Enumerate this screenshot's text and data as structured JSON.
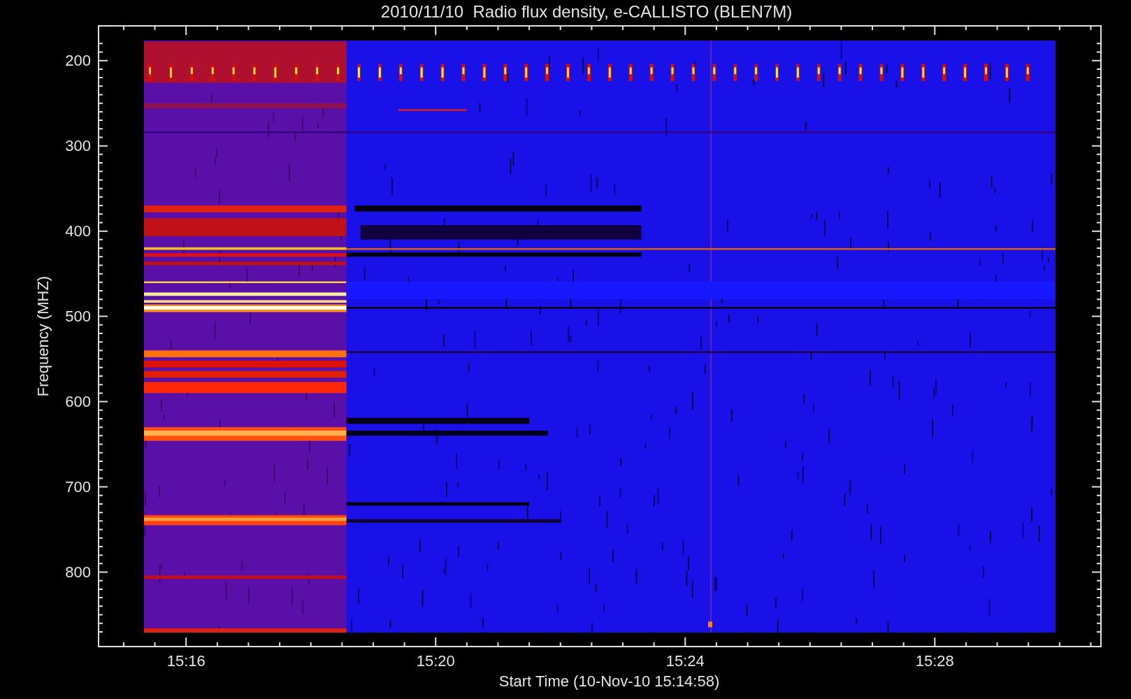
{
  "title": "2010/11/10  Radio flux density, e-CALLISTO (BLEN7M)",
  "y_axis": {
    "label": "Frequency (MHZ)",
    "ticks": [
      "200",
      "300",
      "400",
      "500",
      "600",
      "700",
      "800"
    ]
  },
  "x_axis": {
    "label": "Start Time (10-Nov-10 15:14:58)",
    "ticks": [
      "15:16",
      "15:20",
      "15:24",
      "15:28"
    ]
  }
}
